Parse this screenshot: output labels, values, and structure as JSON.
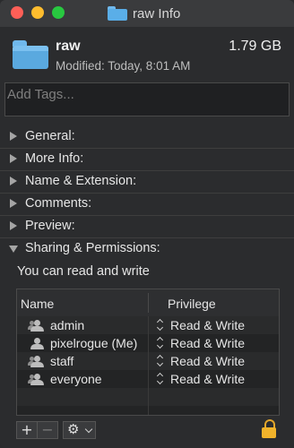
{
  "window": {
    "title": "raw Info"
  },
  "header": {
    "name": "raw",
    "size": "1.79 GB",
    "modified": "Modified: Today, 8:01 AM"
  },
  "tags": {
    "placeholder": "Add Tags..."
  },
  "sections": [
    {
      "label": "General:",
      "expanded": false
    },
    {
      "label": "More Info:",
      "expanded": false
    },
    {
      "label": "Name & Extension:",
      "expanded": false
    },
    {
      "label": "Comments:",
      "expanded": false
    },
    {
      "label": "Preview:",
      "expanded": false
    },
    {
      "label": "Sharing & Permissions:",
      "expanded": true
    }
  ],
  "permissions": {
    "summary": "You can read and write",
    "columns": {
      "name": "Name",
      "privilege": "Privilege"
    },
    "rows": [
      {
        "name": "admin",
        "privilege": "Read & Write",
        "icon": "group-icon"
      },
      {
        "name": "pixelrogue (Me)",
        "privilege": "Read & Write",
        "icon": "user-icon"
      },
      {
        "name": "staff",
        "privilege": "Read & Write",
        "icon": "group-icon"
      },
      {
        "name": "everyone",
        "privilege": "Read & Write",
        "icon": "everyone-icon"
      }
    ]
  },
  "toolbar": {
    "add": "+",
    "remove": "−",
    "action": "⚙"
  },
  "colors": {
    "folder": "#5aaee8",
    "lock": "#f1b32b",
    "close": "#fe5f57",
    "minimize": "#febc2e",
    "maximize": "#28c840"
  }
}
